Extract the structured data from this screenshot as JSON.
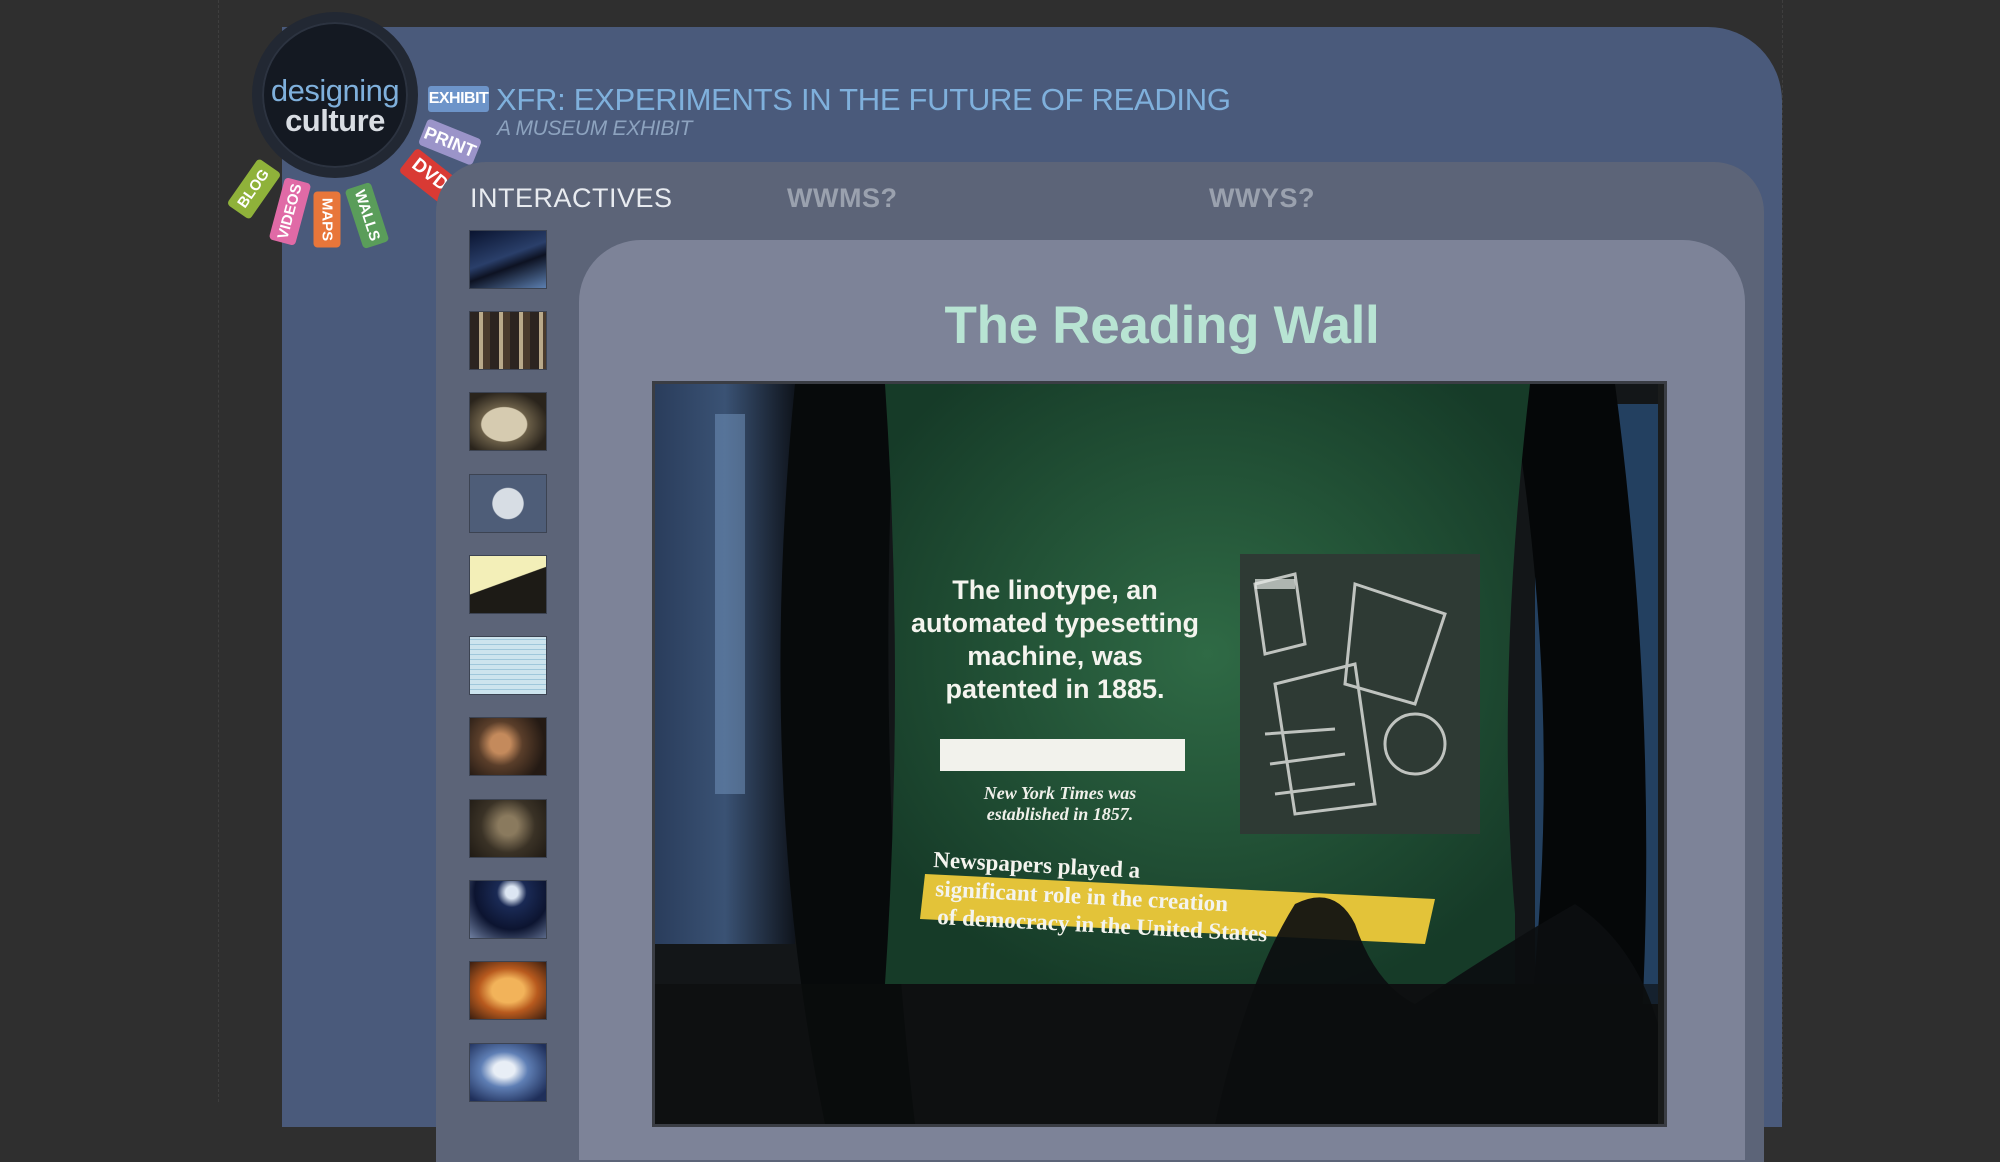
{
  "logo": {
    "line1": "designing",
    "line2": "culture"
  },
  "tags": {
    "exhibit": "EXHIBIT",
    "print": "PRINT",
    "dvd": "DVD",
    "blog": "BLOG",
    "videos": "VIDEOS",
    "maps": "MAPS",
    "walls": "WALLS"
  },
  "header": {
    "title": "XFR: EXPERIMENTS IN THE FUTURE OF READING",
    "subtitle": "A MUSEUM EXHIBIT"
  },
  "tabs": [
    {
      "label": "INTERACTIVES",
      "active": true
    },
    {
      "label": "WWMS?",
      "active": false
    },
    {
      "label": "WWYS?",
      "active": false
    }
  ],
  "thumbnails": [
    {
      "icon": "exhibit-dark-room-thumb"
    },
    {
      "icon": "reading-wall-letters-thumb"
    },
    {
      "icon": "kiosk-machine-thumb"
    },
    {
      "icon": "octagon-diagram-thumb"
    },
    {
      "icon": "lit-table-thumb"
    },
    {
      "icon": "text-page-thumb"
    },
    {
      "icon": "people-viewing-thumb"
    },
    {
      "icon": "portrait-wall-thumb"
    },
    {
      "icon": "screen-console-thumb"
    },
    {
      "icon": "orange-book-thumb"
    },
    {
      "icon": "blue-map-thumb"
    }
  ],
  "main": {
    "title": "The Reading Wall",
    "video": {
      "caption_main": [
        "The linotype, an",
        "automated typesetting",
        "machine, was",
        "patented in 1885."
      ],
      "caption_small": [
        "New York Times was",
        "established in 1857."
      ],
      "caption_bottom": [
        "Newspapers played a",
        "significant role in the creation",
        "of democracy in the United States"
      ]
    }
  },
  "colors": {
    "background": "#2f2f2f",
    "outer_panel": "#4a5a7b",
    "middle_panel": "#5c6478",
    "inner_panel": "#7d8398",
    "title_accent": "#b8e4d3",
    "link_blue": "#7fb0dc"
  }
}
